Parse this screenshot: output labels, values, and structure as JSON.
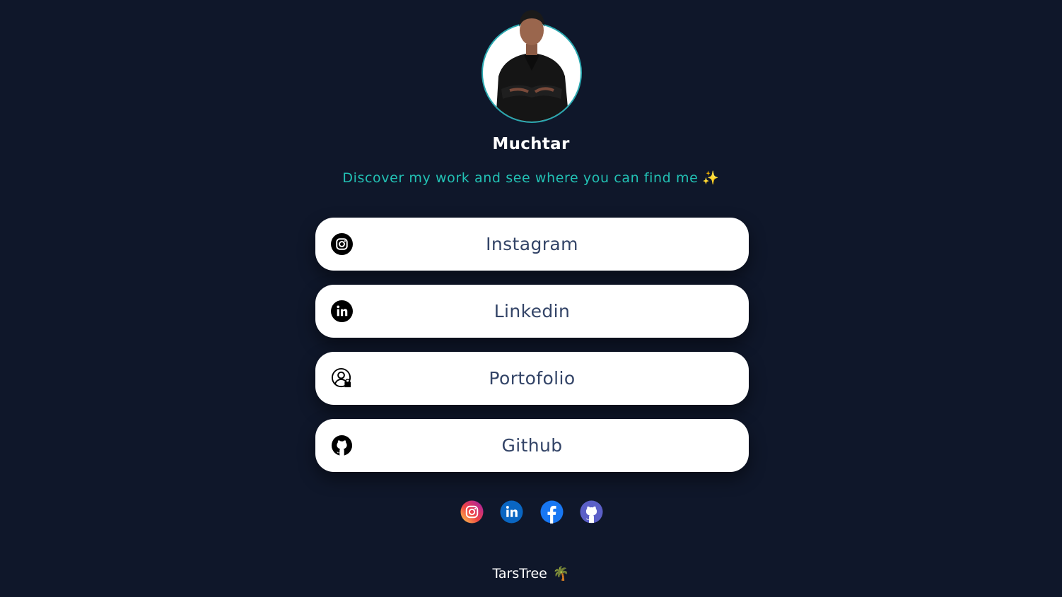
{
  "profile": {
    "name": "Muchtar",
    "bio": "Discover my work and see where you can find me",
    "bio_emoji": "✨"
  },
  "links": [
    {
      "label": "Instagram",
      "icon": "instagram-icon"
    },
    {
      "label": "Linkedin",
      "icon": "linkedin-icon"
    },
    {
      "label": "Portofolio",
      "icon": "portfolio-user-icon"
    },
    {
      "label": "Github",
      "icon": "github-icon"
    }
  ],
  "socials": [
    {
      "icon": "instagram-icon",
      "color": "#e1306c"
    },
    {
      "icon": "linkedin-icon",
      "color": "#0a66c2"
    },
    {
      "icon": "facebook-icon",
      "color": "#1877f2"
    },
    {
      "icon": "github-icon",
      "color": "#5b5fc7"
    }
  ],
  "footer": {
    "brand": "TarsTree",
    "emoji": "🌴"
  },
  "colors": {
    "background": "#0f172a",
    "accent": "#22c1b4",
    "card": "#ffffff",
    "card_text": "#334467"
  }
}
